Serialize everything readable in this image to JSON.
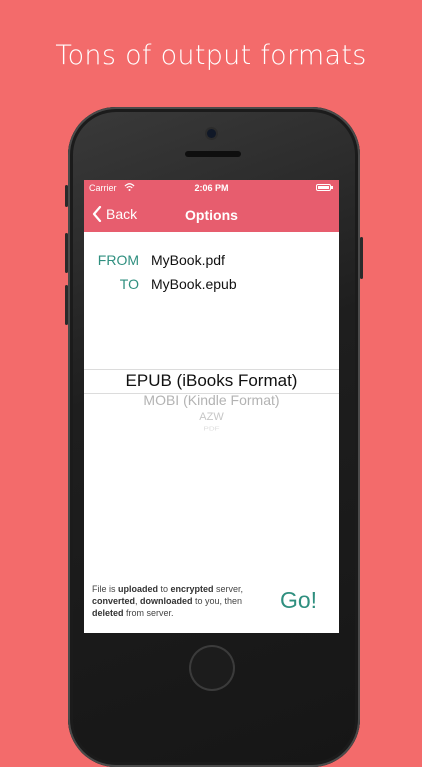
{
  "headline": "Tons of output formats",
  "status_bar": {
    "carrier": "Carrier",
    "time": "2:06 PM",
    "wifi_icon": "wifi-icon",
    "battery_icon": "battery-icon"
  },
  "nav": {
    "back_label": "Back",
    "back_icon": "chevron-left-icon",
    "title": "Options"
  },
  "conversion": {
    "from_label": "FROM",
    "from_value": "MyBook.pdf",
    "to_label": "TO",
    "to_value": "MyBook.epub"
  },
  "format_picker": {
    "options": [
      "EPUB (iBooks Format)",
      "MOBI (Kindle Format)",
      "AZW",
      "PDF"
    ],
    "selected": "EPUB (iBooks Format)"
  },
  "footer": {
    "note": {
      "p1": "File is ",
      "b1": "uploaded",
      "p2": " to ",
      "b2": "encrypted",
      "p3": " server,",
      "b3": "converted",
      "p4": ", ",
      "b4": "downloaded",
      "p5": " to you, then",
      "b5": "deleted",
      "p6": " from server."
    },
    "go_label": "Go!"
  },
  "colors": {
    "background": "#f36b6b",
    "nav_bar": "#e75d6e",
    "accent": "#2f8f7f"
  }
}
